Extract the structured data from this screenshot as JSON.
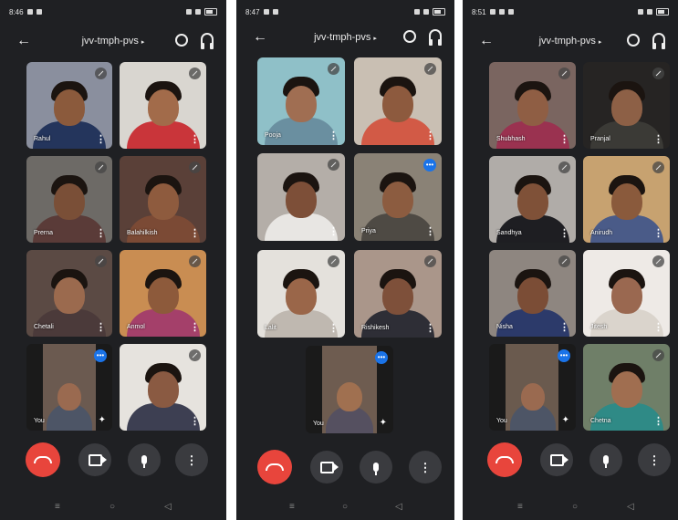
{
  "colors": {
    "background": "#1f2023",
    "end_call": "#e8453c",
    "control_button": "#3a3b3f",
    "speaking_badge": "#1a73e8"
  },
  "phones": [
    {
      "status_time": "8:46",
      "meeting_code": "jvv-tmph-pvs",
      "tiles": [
        {
          "name": "Rahul",
          "indicator": "mute"
        },
        {
          "name": "",
          "indicator": "mute"
        },
        {
          "name": "Prerna",
          "indicator": "mute"
        },
        {
          "name": "Balahilkish",
          "indicator": "mute"
        },
        {
          "name": "Chetali",
          "indicator": "mute"
        },
        {
          "name": "Anmol",
          "indicator": "mute"
        },
        {
          "name": "You",
          "indicator": "speaking"
        },
        {
          "name": "",
          "indicator": "mute"
        }
      ]
    },
    {
      "status_time": "8:47",
      "meeting_code": "jvv-tmph-pvs",
      "tiles": [
        {
          "name": "Pooja",
          "indicator": "mute"
        },
        {
          "name": "",
          "indicator": "mute"
        },
        {
          "name": "",
          "indicator": "mute"
        },
        {
          "name": "Priya",
          "indicator": "speaking"
        },
        {
          "name": "Lalit",
          "indicator": "mute"
        },
        {
          "name": "Rishikesh",
          "indicator": "mute"
        },
        {
          "name": "You",
          "indicator": "speaking"
        }
      ]
    },
    {
      "status_time": "8:51",
      "meeting_code": "jvv-tmph-pvs",
      "tiles": [
        {
          "name": "Shubhash",
          "indicator": "mute"
        },
        {
          "name": "Pranjal",
          "indicator": "mute"
        },
        {
          "name": "Sandhya",
          "indicator": "mute"
        },
        {
          "name": "Anirudh",
          "indicator": "mute"
        },
        {
          "name": "Nisha",
          "indicator": "mute"
        },
        {
          "name": "Jitesh",
          "indicator": "mute"
        },
        {
          "name": "You",
          "indicator": "speaking"
        },
        {
          "name": "Chetna",
          "indicator": "mute"
        }
      ]
    }
  ],
  "icons": {
    "back": "arrow-left-icon",
    "switch_camera": "switch-camera-icon",
    "audio": "headphones-icon",
    "end_call": "phone-hangup-icon",
    "camera": "video-camera-icon",
    "mic": "microphone-icon",
    "more": "more-vert-icon"
  }
}
